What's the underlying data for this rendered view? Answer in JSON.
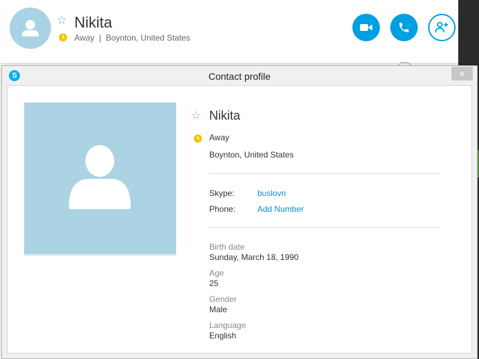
{
  "header": {
    "name": "Nikita",
    "status": "Away",
    "separator": "|",
    "location": "Boynton, United States"
  },
  "dialog": {
    "title": "Contact profile",
    "close_glyph": "×",
    "logo_glyph": "S"
  },
  "profile": {
    "name": "Nikita",
    "status": "Away",
    "location": "Boynton, United States",
    "skype_label": "Skype:",
    "skype_value": "buslovn",
    "phone_label": "Phone:",
    "phone_value": "Add Number",
    "fields": [
      {
        "label": "Birth date",
        "value": "Sunday, March 18, 1990"
      },
      {
        "label": "Age",
        "value": "25"
      },
      {
        "label": "Gender",
        "value": "Male"
      },
      {
        "label": "Language",
        "value": "English"
      }
    ]
  },
  "icons": {
    "favorite": "star-outline-icon",
    "status": "clock-away-icon",
    "video": "video-camera-icon",
    "call": "phone-icon",
    "add_contact": "add-person-icon",
    "close": "close-icon",
    "logo": "skype-logo-icon"
  },
  "colors": {
    "accent": "#009fe3",
    "link": "#0a8fd6",
    "avatar_bg": "#abd3e3",
    "away": "#f5c400"
  }
}
